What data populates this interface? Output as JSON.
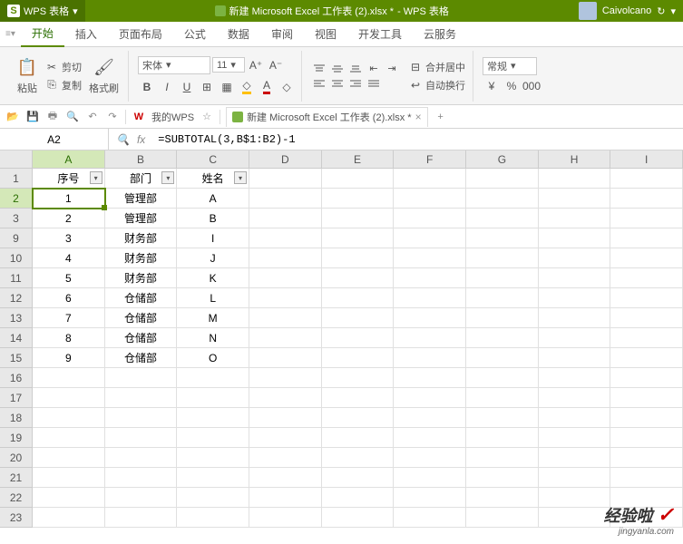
{
  "app": {
    "brand": "WPS 表格",
    "title_doc": "新建 Microsoft Excel 工作表 (2).xlsx *",
    "title_suffix": "- WPS 表格",
    "user": "Caivolcano"
  },
  "menu": {
    "items": [
      "开始",
      "插入",
      "页面布局",
      "公式",
      "数据",
      "审阅",
      "视图",
      "开发工具",
      "云服务"
    ],
    "active": 0
  },
  "ribbon": {
    "paste": "粘贴",
    "cut": "剪切",
    "copy": "复制",
    "format_painter": "格式刷",
    "font_name": "宋体",
    "font_size": "11",
    "merge": "合并居中",
    "wrap": "自动换行",
    "number_format": "常规"
  },
  "quickbar": {
    "mywps": "我的WPS",
    "doc_tab": "新建 Microsoft Excel 工作表 (2).xlsx *"
  },
  "formula_bar": {
    "cell_ref": "A2",
    "fx": "fx",
    "formula": "=SUBTOTAL(3,B$1:B2)-1"
  },
  "grid": {
    "cols": [
      "A",
      "B",
      "C",
      "D",
      "E",
      "F",
      "G",
      "H",
      "I"
    ],
    "row_numbers": [
      1,
      2,
      3,
      9,
      10,
      11,
      12,
      13,
      14,
      15,
      16,
      17,
      18,
      19,
      20,
      21,
      22,
      23
    ],
    "headers": [
      "序号",
      "部门",
      "姓名"
    ],
    "rows": [
      {
        "r": 2,
        "a": "1",
        "b": "管理部",
        "c": "A"
      },
      {
        "r": 3,
        "a": "2",
        "b": "管理部",
        "c": "B"
      },
      {
        "r": 9,
        "a": "3",
        "b": "财务部",
        "c": "I"
      },
      {
        "r": 10,
        "a": "4",
        "b": "财务部",
        "c": "J"
      },
      {
        "r": 11,
        "a": "5",
        "b": "财务部",
        "c": "K"
      },
      {
        "r": 12,
        "a": "6",
        "b": "仓储部",
        "c": "L"
      },
      {
        "r": 13,
        "a": "7",
        "b": "仓储部",
        "c": "M"
      },
      {
        "r": 14,
        "a": "8",
        "b": "仓储部",
        "c": "N"
      },
      {
        "r": 15,
        "a": "9",
        "b": "仓储部",
        "c": "O"
      }
    ],
    "active_cell": "A2",
    "active_col": "A",
    "active_row": 2
  },
  "watermark": {
    "line1": "经验啦",
    "line2": "jingyanla.com"
  }
}
